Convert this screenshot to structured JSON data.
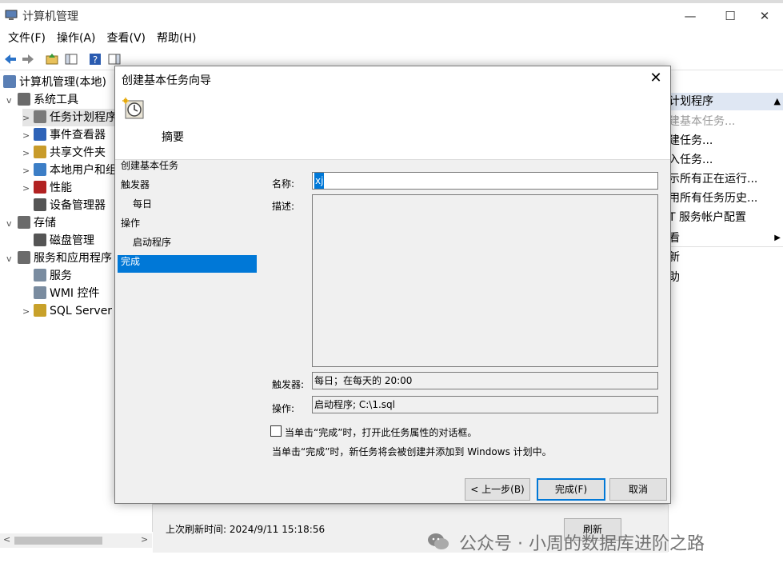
{
  "window": {
    "title": "计算机管理",
    "menus": [
      "文件(F)",
      "操作(A)",
      "查看(V)",
      "帮助(H)"
    ],
    "controls": {
      "minimize": "—",
      "maximize": "☐",
      "close": "✕"
    }
  },
  "tree": {
    "root": "计算机管理(本地)",
    "items": [
      {
        "label": "系统工具",
        "exp": "v",
        "color": "#6b6b6b"
      },
      {
        "label": "任务计划程序",
        "exp": ">",
        "color": "#7a7a7a"
      },
      {
        "label": "事件查看器",
        "exp": ">",
        "color": "#2e63b8"
      },
      {
        "label": "共享文件夹",
        "exp": ">",
        "color": "#c89b2a"
      },
      {
        "label": "本地用户和组",
        "exp": ">",
        "color": "#3c7ec6"
      },
      {
        "label": "性能",
        "exp": ">",
        "color": "#b22222"
      },
      {
        "label": "设备管理器",
        "exp": "",
        "color": "#555555"
      },
      {
        "label": "存储",
        "exp": "v",
        "color": "#6b6b6b"
      },
      {
        "label": "磁盘管理",
        "exp": "",
        "color": "#555555"
      },
      {
        "label": "服务和应用程序",
        "exp": "v",
        "color": "#6b6b6b"
      },
      {
        "label": "服务",
        "exp": "",
        "color": "#7a8ca0"
      },
      {
        "label": "WMI 控件",
        "exp": "",
        "color": "#7a8ca0"
      },
      {
        "label": "SQL Server",
        "exp": ">",
        "color": "#c8a12a"
      }
    ]
  },
  "actions": {
    "header": "计划程序",
    "items": [
      "建基本任务...",
      "建任务...",
      "入任务...",
      "示所有正在运行...",
      "用所有任务历史...",
      "T 服务帐户配置",
      "看",
      "新",
      "助"
    ]
  },
  "dialog": {
    "title": "创建基本任务向导",
    "header": "摘要",
    "steps": [
      {
        "label": "创建基本任务",
        "indent": false
      },
      {
        "label": "触发器",
        "indent": false
      },
      {
        "label": "每日",
        "indent": true
      },
      {
        "label": "操作",
        "indent": false
      },
      {
        "label": "启动程序",
        "indent": true
      },
      {
        "label": "完成",
        "indent": false,
        "selected": true
      }
    ],
    "labels": {
      "name": "名称:",
      "description": "描述:",
      "trigger": "触发器:",
      "action": "操作:"
    },
    "values": {
      "name": "xj",
      "description": "",
      "trigger": "每日；在每天的 20:00",
      "action": "启动程序; C:\\1.sql"
    },
    "checkbox_label": "当单击“完成”时，打开此任务属性的对话框。",
    "checkbox_checked": false,
    "info": "当单击“完成”时，新任务将会被创建并添加到 Windows 计划中。",
    "buttons": {
      "back": "< 上一步(B)",
      "finish": "完成(F)",
      "cancel": "取消"
    }
  },
  "status": {
    "last_refresh": "上次刷新时间: 2024/9/11 15:18:56",
    "refresh_button": "刷新"
  },
  "watermark": "公众号 · 小周的数据库进阶之路"
}
